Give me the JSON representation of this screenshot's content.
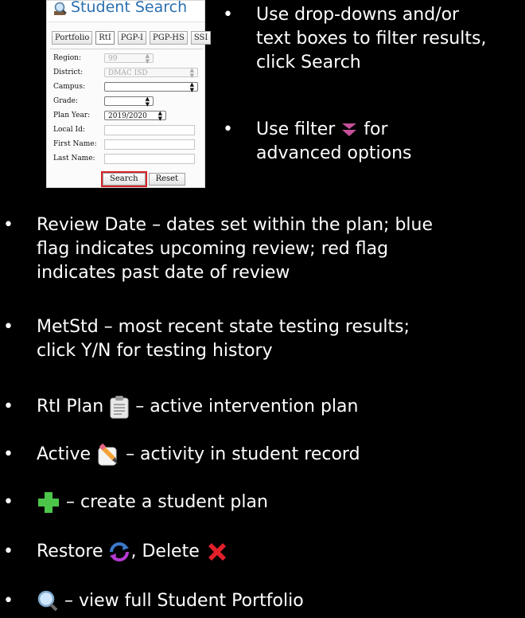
{
  "panel": {
    "title": "Student Search",
    "tabs": [
      "Portfolio",
      "RtI",
      "PGP-I",
      "PGP-HS",
      "SSI"
    ],
    "fields": {
      "region": {
        "label": "Region:",
        "value": "99"
      },
      "district": {
        "label": "District:",
        "value": "DMAC ISD"
      },
      "campus": {
        "label": "Campus:",
        "value": ""
      },
      "grade": {
        "label": "Grade:",
        "value": ""
      },
      "plan_year": {
        "label": "Plan Year:",
        "value": "2019/2020"
      },
      "local_id": {
        "label": "Local Id:",
        "value": ""
      },
      "first_name": {
        "label": "First Name:",
        "value": ""
      },
      "last_name": {
        "label": "Last Name:",
        "value": ""
      }
    },
    "buttons": {
      "search": "Search",
      "reset": "Reset"
    }
  },
  "bullets": {
    "filter": [
      "Use drop-downs and/or",
      "text boxes to filter results,",
      "click Search"
    ],
    "advanced_pre": "Use filter",
    "advanced_post": "for",
    "advanced_line2": "advanced options",
    "review": [
      "Review Date – dates set within the plan; blue",
      "flag indicates upcoming review; red flag",
      "indicates past date of review"
    ],
    "metstd": [
      "MetStd – most recent state testing results;",
      "click Y/N for testing history"
    ],
    "rti_pre": "RtI Plan",
    "rti_post": "– active intervention plan",
    "active_pre": "Active",
    "active_post": "– activity in student record",
    "create_post": "– create a student plan",
    "restore_pre": "Restore",
    "restore_mid": ", Delete",
    "portfolio_post": "– view full Student Portfolio"
  },
  "icons": {
    "search": "magnifier-icon",
    "filter": "filter-chevron-icon",
    "rti": "clipboard-icon",
    "active": "edit-note-icon",
    "create": "plus-icon",
    "restore": "restore-arrows-icon",
    "delete": "red-x-icon"
  },
  "colors": {
    "background": "#000000",
    "title": "#2a6fb0",
    "highlight": "#d4242a",
    "filter": "#c4509a",
    "plus": "#4cc64a",
    "delete": "#e2202a"
  }
}
